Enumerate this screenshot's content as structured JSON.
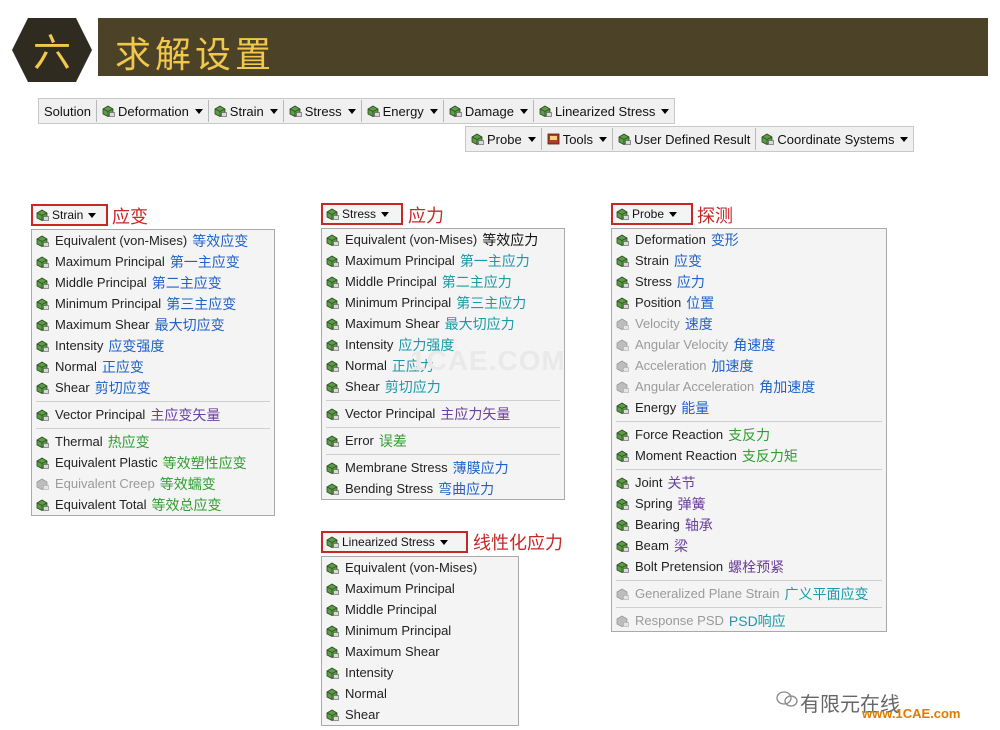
{
  "header": {
    "number": "六",
    "title": "求解设置",
    "hex_color": "#2f2b20",
    "bar_color": "#4b4228",
    "accent": "#f2c84b"
  },
  "toolbar1": [
    "Solution",
    "Deformation",
    "Strain",
    "Stress",
    "Energy",
    "Damage",
    "Linearized Stress"
  ],
  "toolbar2": [
    "Probe",
    "Tools",
    "User Defined Result",
    "Coordinate Systems"
  ],
  "strain": {
    "button": "Strain",
    "title": "应变",
    "items": [
      {
        "en": "Equivalent (von-Mises)",
        "cn": "等效应变",
        "color": "blue"
      },
      {
        "en": "Maximum Principal",
        "cn": "第一主应变",
        "color": "blue"
      },
      {
        "en": "Middle Principal",
        "cn": "第二主应变",
        "color": "blue"
      },
      {
        "en": "Minimum Principal",
        "cn": "第三主应变",
        "color": "blue"
      },
      {
        "en": "Maximum Shear",
        "cn": "最大切应变",
        "color": "blue"
      },
      {
        "en": "Intensity",
        "cn": "应变强度",
        "color": "blue"
      },
      {
        "en": "Normal",
        "cn": "正应变",
        "color": "blue"
      },
      {
        "en": "Shear",
        "cn": "剪切应变",
        "color": "blue"
      },
      {
        "sep": true
      },
      {
        "en": "Vector Principal",
        "cn": "主应变矢量",
        "color": "purple"
      },
      {
        "sep": true
      },
      {
        "en": "Thermal",
        "cn": "热应变",
        "color": "green"
      },
      {
        "en": "Equivalent Plastic",
        "cn": "等效塑性应变",
        "color": "green"
      },
      {
        "en": "Equivalent Creep",
        "cn": "等效蠕变",
        "color": "green",
        "disabled": true
      },
      {
        "en": "Equivalent Total",
        "cn": "等效总应变",
        "color": "green"
      }
    ]
  },
  "stress": {
    "button": "Stress",
    "title": "应力",
    "items": [
      {
        "en": "Equivalent (von-Mises)",
        "cn": "等效应力",
        "color": "black"
      },
      {
        "en": "Maximum Principal",
        "cn": "第一主应力",
        "color": "teal"
      },
      {
        "en": "Middle Principal",
        "cn": "第二主应力",
        "color": "teal"
      },
      {
        "en": "Minimum Principal",
        "cn": "第三主应力",
        "color": "teal"
      },
      {
        "en": "Maximum Shear",
        "cn": "最大切应力",
        "color": "teal"
      },
      {
        "en": "Intensity",
        "cn": "应力强度",
        "color": "teal"
      },
      {
        "en": "Normal",
        "cn": "正应力",
        "color": "teal"
      },
      {
        "en": "Shear",
        "cn": "剪切应力",
        "color": "teal"
      },
      {
        "sep": true
      },
      {
        "en": "Vector Principal",
        "cn": "主应力矢量",
        "color": "purple"
      },
      {
        "sep": true
      },
      {
        "en": "Error",
        "cn": "误差",
        "color": "green"
      },
      {
        "sep": true
      },
      {
        "en": "Membrane Stress",
        "cn": "薄膜应力",
        "color": "blue"
      },
      {
        "en": "Bending Stress",
        "cn": "弯曲应力",
        "color": "blue"
      }
    ]
  },
  "linearized": {
    "button": "Linearized Stress",
    "title": "线性化应力",
    "items": [
      {
        "en": "Equivalent (von-Mises)"
      },
      {
        "en": "Maximum Principal"
      },
      {
        "en": "Middle Principal"
      },
      {
        "en": "Minimum Principal"
      },
      {
        "en": "Maximum Shear"
      },
      {
        "en": "Intensity"
      },
      {
        "en": "Normal"
      },
      {
        "en": "Shear"
      }
    ]
  },
  "probe": {
    "button": "Probe",
    "title": "探测",
    "items": [
      {
        "en": "Deformation",
        "cn": "变形",
        "color": "blue"
      },
      {
        "en": "Strain",
        "cn": "应变",
        "color": "blue"
      },
      {
        "en": "Stress",
        "cn": "应力",
        "color": "blue"
      },
      {
        "en": "Position",
        "cn": "位置",
        "color": "blue"
      },
      {
        "en": "Velocity",
        "cn": "速度",
        "color": "blue",
        "disabled": true
      },
      {
        "en": "Angular Velocity",
        "cn": "角速度",
        "color": "blue",
        "disabled": true
      },
      {
        "en": "Acceleration",
        "cn": "加速度",
        "color": "blue",
        "disabled": true
      },
      {
        "en": "Angular Acceleration",
        "cn": "角加速度",
        "color": "blue",
        "disabled": true
      },
      {
        "en": "Energy",
        "cn": "能量",
        "color": "blue"
      },
      {
        "sep": true
      },
      {
        "en": "Force Reaction",
        "cn": "支反力",
        "color": "green"
      },
      {
        "en": "Moment Reaction",
        "cn": "支反力矩",
        "color": "green"
      },
      {
        "sep": true
      },
      {
        "en": "Joint",
        "cn": "关节",
        "color": "purple"
      },
      {
        "en": "Spring",
        "cn": "弹簧",
        "color": "purple"
      },
      {
        "en": "Bearing",
        "cn": "轴承",
        "color": "purple"
      },
      {
        "en": "Beam",
        "cn": "梁",
        "color": "purple"
      },
      {
        "en": "Bolt Pretension",
        "cn": "螺栓预紧",
        "color": "purple"
      },
      {
        "sep": true
      },
      {
        "en": "Generalized Plane Strain",
        "cn": "广义平面应变",
        "color": "teal",
        "disabled": true
      },
      {
        "sep": true
      },
      {
        "en": "Response PSD",
        "cn": "PSD响应",
        "color": "teal",
        "disabled": true
      }
    ]
  },
  "watermark": {
    "center": "1CAE.COM",
    "brand": "有限元在线",
    "site": "www.1CAE.com"
  }
}
